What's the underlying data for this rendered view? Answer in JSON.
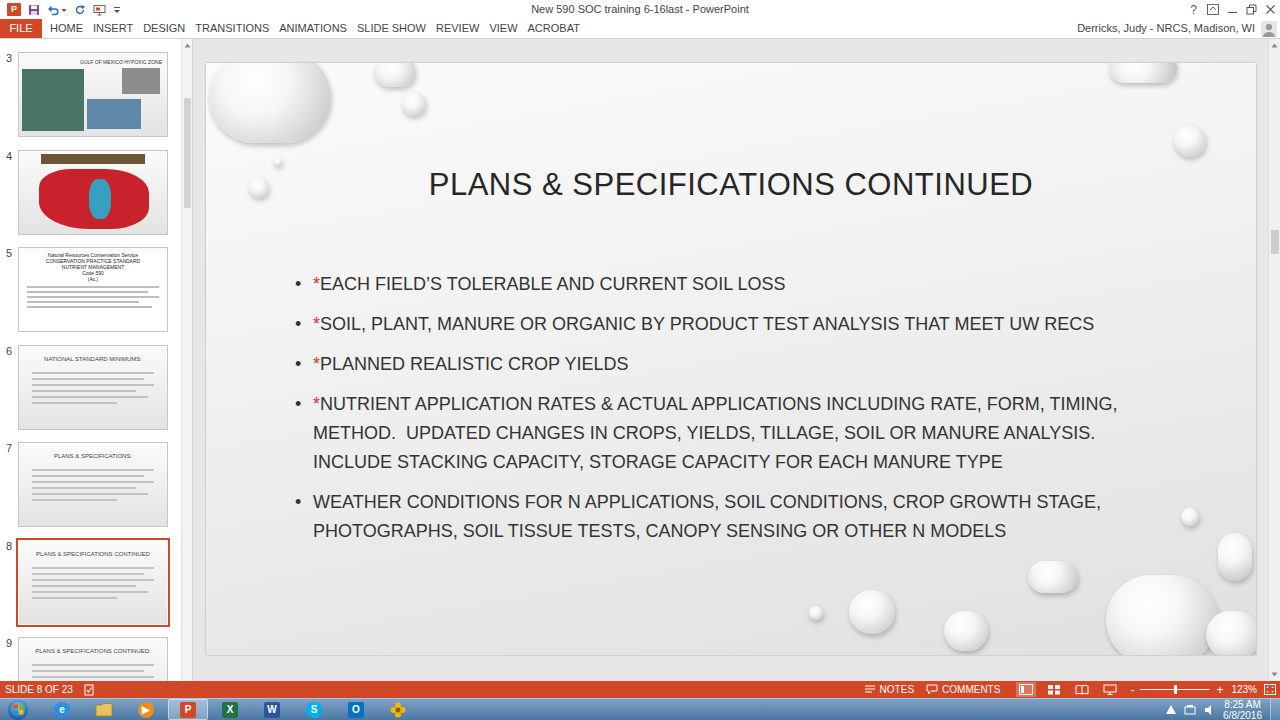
{
  "window": {
    "title": "New 590 SOC training 6-16last - PowerPoint",
    "app_glyph": "P",
    "help": "?"
  },
  "ribbon": {
    "tabs": [
      {
        "label": "FILE",
        "kind": "file",
        "selected": false
      },
      {
        "label": "HOME",
        "kind": "tab",
        "selected": false
      },
      {
        "label": "INSERT",
        "kind": "tab",
        "selected": false
      },
      {
        "label": "DESIGN",
        "kind": "tab",
        "selected": false
      },
      {
        "label": "TRANSITIONS",
        "kind": "tab",
        "selected": false
      },
      {
        "label": "ANIMATIONS",
        "kind": "tab",
        "selected": false
      },
      {
        "label": "SLIDE SHOW",
        "kind": "tab",
        "selected": false
      },
      {
        "label": "REVIEW",
        "kind": "tab",
        "selected": false
      },
      {
        "label": "VIEW",
        "kind": "tab",
        "selected": false
      },
      {
        "label": "ACROBAT",
        "kind": "tab",
        "selected": false
      }
    ],
    "user": "Derricks, Judy - NRCS, Madison, WI"
  },
  "thumbnails": [
    {
      "number": "3",
      "kind": "photos",
      "title": "GULF OF MEXICO HYPOXIC ZONE",
      "selected": false
    },
    {
      "number": "4",
      "kind": "map",
      "selected": false
    },
    {
      "number": "5",
      "kind": "document",
      "lines": [
        "Natural Resources Conservation Service",
        "CONSERVATION PRACTICE STANDARD",
        "NUTRIENT MANAGEMENT",
        "Code 590",
        "(Ac.)"
      ],
      "selected": false
    },
    {
      "number": "6",
      "kind": "bullets",
      "title": "NATIONAL STANDARD MINIMUMS:",
      "selected": false
    },
    {
      "number": "7",
      "kind": "bullets",
      "title": "PLANS & SPECIFICATIONS:",
      "selected": false
    },
    {
      "number": "8",
      "kind": "bullets",
      "title": "PLANS & SPECIFICATIONS CONTINUED",
      "selected": true
    },
    {
      "number": "9",
      "kind": "bullets",
      "title": "PLANS & SPECIFICATIONS CONTINUED:",
      "selected": false
    }
  ],
  "slide": {
    "title": "PLANS & SPECIFICATIONS CONTINUED",
    "bullets": [
      {
        "symbol": "•",
        "mark": "*",
        "lines": [
          "EACH FIELD’S TOLERABLE AND CURRENT SOIL LOSS"
        ]
      },
      {
        "symbol": "•",
        "mark": "*",
        "lines": [
          "SOIL, PLANT, MANURE OR ORGANIC BY PRODUCT TEST ANALYSIS THAT MEET UW RECS"
        ]
      },
      {
        "symbol": "•",
        "mark": "*",
        "lines": [
          "PLANNED REALISTIC CROP YIELDS"
        ]
      },
      {
        "symbol": "•",
        "mark": "*",
        "lines": [
          "NUTRIENT APPLICATION RATES & ACTUAL APPLICATIONS INCLUDING RATE, FORM, TIMING,",
          "METHOD.  UPDATED CHANGES IN CROPS, YIELDS, TILLAGE, SOIL OR MANURE ANALYSIS.",
          "INCLUDE STACKING CAPACITY, STORAGE CAPACITY FOR EACH MANURE TYPE"
        ]
      },
      {
        "symbol": "•",
        "lines": [
          "WEATHER CONDITIONS FOR N APPLICATIONS, SOIL CONDITIONS, CROP GROWTH STAGE,",
          "PHOTOGRAPHS, SOIL TISSUE TESTS, CANOPY SENSING OR OTHER N MODELS"
        ]
      }
    ]
  },
  "status_bar": {
    "slide_info": "SLIDE 8 OF 23",
    "notes": "NOTES",
    "comments": "COMMENTS",
    "views": [
      {
        "kind": "normal",
        "selected": true
      },
      {
        "kind": "sorter",
        "selected": false
      },
      {
        "kind": "reading",
        "selected": false
      },
      {
        "kind": "slideshow",
        "selected": false
      }
    ],
    "zoom_out": "-",
    "zoom_in": "+",
    "zoom": "123%",
    "zoom_level": 0.5
  },
  "taskbar": {
    "apps": [
      {
        "kind": "browser",
        "glyph": "e",
        "color": "#2b8fe0",
        "selected": false
      },
      {
        "kind": "folder",
        "color": "#e8c25a",
        "selected": false
      },
      {
        "kind": "media",
        "glyph": "▶",
        "color": "#f08c1a",
        "selected": false
      },
      {
        "kind": "powerpoint",
        "glyph": "P",
        "color": "#d24726",
        "selected": true
      },
      {
        "kind": "excel",
        "glyph": "X",
        "color": "#1f7244",
        "selected": false
      },
      {
        "kind": "word",
        "glyph": "W",
        "color": "#2b579a",
        "selected": false
      },
      {
        "kind": "skype",
        "glyph": "S",
        "color": "#00aff0",
        "selected": false
      },
      {
        "kind": "outlook",
        "glyph": "O",
        "color": "#0072c6",
        "selected": false
      },
      {
        "kind": "flower",
        "color": "#f5b800",
        "selected": false
      }
    ],
    "time": "8:25 AM",
    "date": "6/8/2016"
  }
}
